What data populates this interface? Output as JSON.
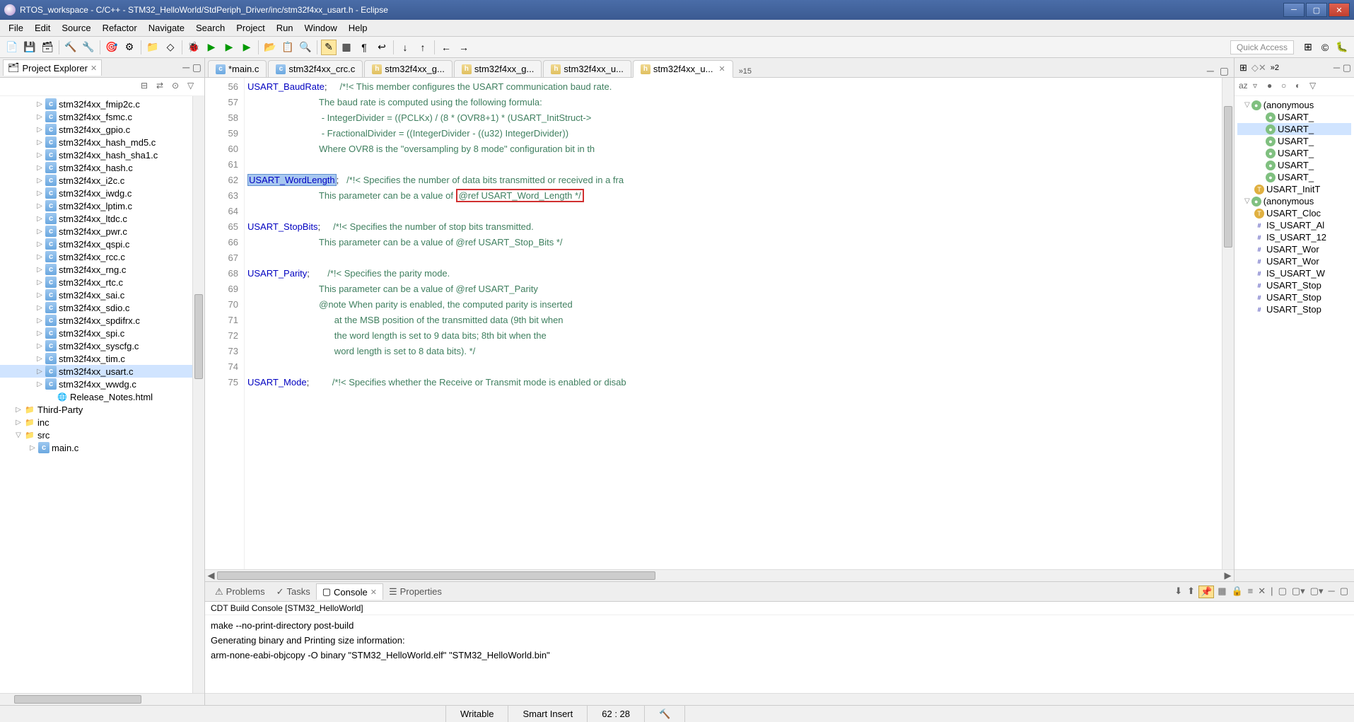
{
  "window": {
    "title": "RTOS_workspace - C/C++ - STM32_HelloWorld/StdPeriph_Driver/inc/stm32f4xx_usart.h - Eclipse"
  },
  "menu": [
    "File",
    "Edit",
    "Source",
    "Refactor",
    "Navigate",
    "Search",
    "Project",
    "Run",
    "Window",
    "Help"
  ],
  "quick_access": "Quick Access",
  "explorer": {
    "title": "Project Explorer",
    "files": [
      "stm32f4xx_fmip2c.c",
      "stm32f4xx_fsmc.c",
      "stm32f4xx_gpio.c",
      "stm32f4xx_hash_md5.c",
      "stm32f4xx_hash_sha1.c",
      "stm32f4xx_hash.c",
      "stm32f4xx_i2c.c",
      "stm32f4xx_iwdg.c",
      "stm32f4xx_lptim.c",
      "stm32f4xx_ltdc.c",
      "stm32f4xx_pwr.c",
      "stm32f4xx_qspi.c",
      "stm32f4xx_rcc.c",
      "stm32f4xx_rng.c",
      "stm32f4xx_rtc.c",
      "stm32f4xx_sai.c",
      "stm32f4xx_sdio.c",
      "stm32f4xx_spdifrx.c",
      "stm32f4xx_spi.c",
      "stm32f4xx_syscfg.c",
      "stm32f4xx_tim.c",
      "stm32f4xx_usart.c",
      "stm32f4xx_wwdg.c"
    ],
    "html_file": "Release_Notes.html",
    "folders": [
      "Third-Party",
      "inc",
      "src"
    ],
    "src_child": "main.c"
  },
  "editor": {
    "tabs": [
      {
        "label": "*main.c",
        "active": false
      },
      {
        "label": "stm32f4xx_crc.c",
        "active": false
      },
      {
        "label": "stm32f4xx_g...",
        "active": false
      },
      {
        "label": "stm32f4xx_g...",
        "active": false
      },
      {
        "label": "stm32f4xx_u...",
        "active": false
      },
      {
        "label": "stm32f4xx_u...",
        "active": true
      }
    ],
    "more": "»15",
    "lines": {
      "56": {
        "field": "USART_BaudRate",
        "after": ";",
        "comment": "/*!< This member configures the USART communication baud rate."
      },
      "57": {
        "comment": "                            The baud rate is computed using the following formula:"
      },
      "58": {
        "comment": "                             - IntegerDivider = ((PCLKx) / (8 * (OVR8+1) * (USART_InitStruct->"
      },
      "59": {
        "comment": "                             - FractionalDivider = ((IntegerDivider - ((u32) IntegerDivider))"
      },
      "60": {
        "comment": "                            Where OVR8 is the \"oversampling by 8 mode\" configuration bit in th"
      },
      "61": {
        "comment": ""
      },
      "62": {
        "field": "USART_WordLength",
        "after": ";",
        "comment": "/*!< Specifies the number of data bits transmitted or received in a fra"
      },
      "63": {
        "comment_pre": "                            This parameter can be a value of ",
        "comment_box": "@ref USART_Word_Length */"
      },
      "64": {
        "comment": ""
      },
      "65": {
        "field": "USART_StopBits",
        "after": ";",
        "comment": "/*!< Specifies the number of stop bits transmitted."
      },
      "66": {
        "comment": "                            This parameter can be a value of @ref USART_Stop_Bits */"
      },
      "67": {
        "comment": ""
      },
      "68": {
        "field": "USART_Parity",
        "after": ";",
        "comment": "/*!< Specifies the parity mode."
      },
      "69": {
        "comment": "                            This parameter can be a value of @ref USART_Parity"
      },
      "70": {
        "comment": "                            @note When parity is enabled, the computed parity is inserted"
      },
      "71": {
        "comment": "                                  at the MSB position of the transmitted data (9th bit when"
      },
      "72": {
        "comment": "                                  the word length is set to 9 data bits; 8th bit when the"
      },
      "73": {
        "comment": "                                  word length is set to 8 data bits). */"
      },
      "74": {
        "comment": ""
      },
      "75": {
        "field": "USART_Mode",
        "after": ";",
        "comment": "/*!< Specifies whether the Receive or Transmit mode is enabled or disab"
      }
    }
  },
  "outline": {
    "items": [
      {
        "label": "(anonymous",
        "icon": "circle",
        "exp": true
      },
      {
        "label": "USART_",
        "icon": "circle",
        "indent": true
      },
      {
        "label": "USART_",
        "icon": "circle",
        "indent": true,
        "sel": true
      },
      {
        "label": "USART_",
        "icon": "circle",
        "indent": true
      },
      {
        "label": "USART_",
        "icon": "circle",
        "indent": true
      },
      {
        "label": "USART_",
        "icon": "circle",
        "indent": true
      },
      {
        "label": "USART_",
        "icon": "circle",
        "indent": true
      },
      {
        "label": "USART_InitT",
        "icon": "type"
      },
      {
        "label": "(anonymous",
        "icon": "circle",
        "exp": true
      },
      {
        "label": "USART_Cloc",
        "icon": "type"
      },
      {
        "label": "IS_USART_Al",
        "icon": "hash"
      },
      {
        "label": "IS_USART_12",
        "icon": "hash"
      },
      {
        "label": "USART_Wor",
        "icon": "hash"
      },
      {
        "label": "USART_Wor",
        "icon": "hash"
      },
      {
        "label": "IS_USART_W",
        "icon": "hash"
      },
      {
        "label": "USART_Stop",
        "icon": "hash"
      },
      {
        "label": "USART_Stop",
        "icon": "hash"
      },
      {
        "label": "USART_Stop",
        "icon": "hash"
      }
    ]
  },
  "bottom": {
    "tabs": [
      "Problems",
      "Tasks",
      "Console",
      "Properties"
    ],
    "active_tab": 2,
    "console_title": "CDT Build Console [STM32_HelloWorld]",
    "console_lines": [
      "make --no-print-directory post-build",
      "Generating binary and Printing size information:",
      "arm-none-eabi-objcopy -O binary \"STM32_HelloWorld.elf\" \"STM32_HelloWorld.bin\""
    ]
  },
  "status": {
    "writable": "Writable",
    "insert": "Smart Insert",
    "pos": "62 : 28"
  }
}
